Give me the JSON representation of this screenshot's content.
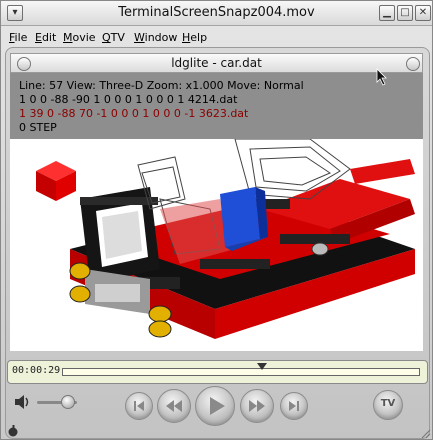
{
  "window": {
    "title": "TerminalScreenSnapz004.mov"
  },
  "menu": [
    "File",
    "Edit",
    "Movie",
    "QTV",
    "Window",
    "Help"
  ],
  "menu_underlines": [
    "F",
    "E",
    "M",
    "Q",
    "W",
    "H"
  ],
  "ldglite": {
    "title": "ldglite - car.dat",
    "status_lines": [
      "Line: 57  View: Three-D  Zoom: x1.000  Move: Normal",
      "1 0 0 -88 -90 1 0 0 0 1 0 0 0 1 4214.dat",
      "1 39 0 -88 70 -1 0 0 0 1 0 0 0 -1 3623.dat",
      "0 STEP"
    ]
  },
  "timeline": {
    "timecode": "00:00:29",
    "progress": 0.56
  },
  "volume": {
    "level": 0.75
  },
  "icons": {
    "volume": "speaker-icon",
    "step_back": "step-back-icon",
    "rewind": "rewind-icon",
    "play": "play-icon",
    "fast_forward": "fast-forward-icon",
    "step_forward": "step-forward-icon",
    "tv": "tv-icon"
  },
  "tv_label": "TV",
  "colors": {
    "brick_red": "#d10000",
    "brick_black": "#1a1a1a",
    "brick_blue": "#1f4fd6",
    "brick_yellow": "#e2b000",
    "status_bg": "#8e8e8e"
  }
}
